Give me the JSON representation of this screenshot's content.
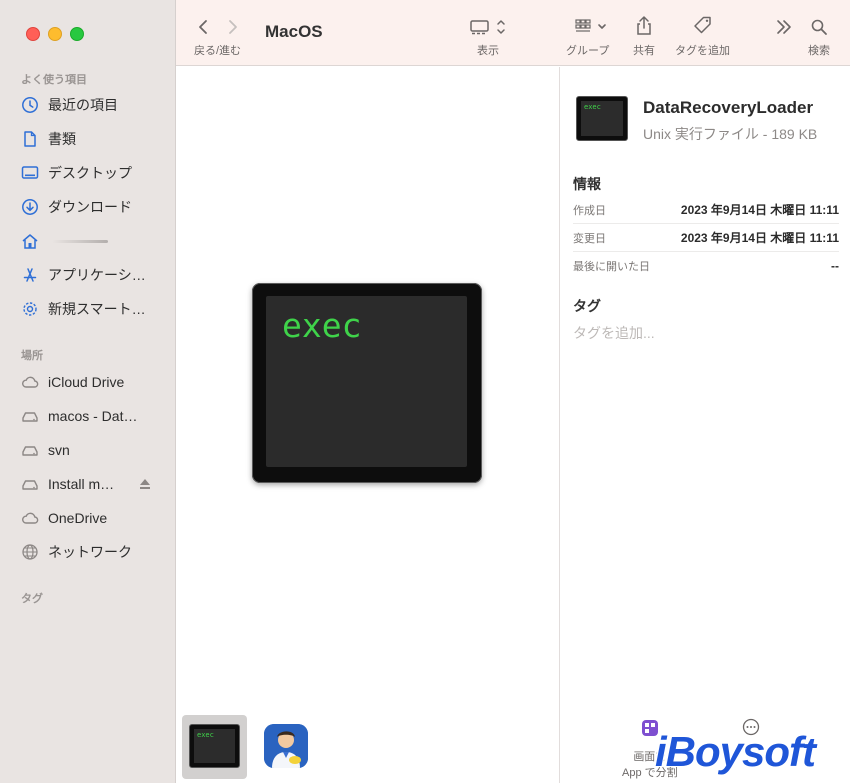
{
  "window": {
    "title": "MacOS"
  },
  "sidebar": {
    "favorites_title": "よく使う項目",
    "favorites": [
      {
        "label": "最近の項目",
        "icon": "clock-icon"
      },
      {
        "label": "書類",
        "icon": "document-icon"
      },
      {
        "label": "デスクトップ",
        "icon": "desktop-icon"
      },
      {
        "label": "ダウンロード",
        "icon": "download-icon"
      },
      {
        "label": "",
        "icon": "home-icon"
      },
      {
        "label": "アプリケーシ…",
        "icon": "applications-icon"
      },
      {
        "label": "新規スマート…",
        "icon": "gear-icon"
      }
    ],
    "locations_title": "場所",
    "locations": [
      {
        "label": "iCloud Drive",
        "icon": "cloud-icon"
      },
      {
        "label": "macos - Dat…",
        "icon": "drive-icon"
      },
      {
        "label": "svn",
        "icon": "drive-icon"
      },
      {
        "label": "Install m…",
        "icon": "drive-icon"
      },
      {
        "label": "OneDrive",
        "icon": "cloud-icon"
      },
      {
        "label": "ネットワーク",
        "icon": "network-icon"
      }
    ],
    "tags_title": "タグ"
  },
  "toolbar": {
    "back_forward_label": "戻る/進む",
    "view_label": "表示",
    "group_label": "グループ",
    "share_label": "共有",
    "tag_label": "タグを追加",
    "search_label": "検索"
  },
  "preview": {
    "icon_text": "exec",
    "thumb_text": "exec"
  },
  "info": {
    "file_name": "DataRecoveryLoader",
    "file_kind": "Unix 実行ファイル - 189 KB",
    "info_heading": "情報",
    "rows": [
      {
        "key": "作成日",
        "value": "2023 年9月14日 木曜日 11:11"
      },
      {
        "key": "変更日",
        "value": "2023 年9月14日 木曜日 11:11"
      },
      {
        "key": "最後に開いた日",
        "value": "--"
      }
    ],
    "tags_heading": "タグ",
    "tags_placeholder": "タグを追加..."
  },
  "bottom_tools": {
    "split_label_1": "画面を",
    "split_label_2": "App で分割"
  },
  "watermark": "iBoysoft",
  "colors": {
    "sidebar_bg": "#e9e4e2",
    "toolbar_bg": "#fcf1ee",
    "accent": "#2f6fd6",
    "exec_green": "#3fd34a",
    "watermark_blue": "#1f56d8"
  }
}
